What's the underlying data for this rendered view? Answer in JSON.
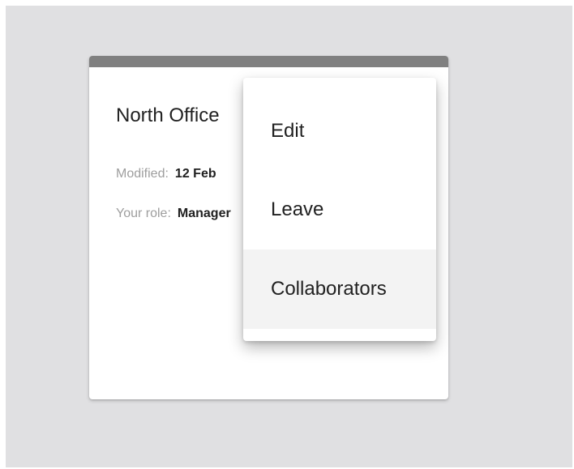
{
  "card": {
    "title": "North Office",
    "modified_label": "Modified:",
    "modified_value": "12 Feb",
    "role_label": "Your role:",
    "role_value": "Manager",
    "topbar_color": "#808080"
  },
  "menu": {
    "items": [
      {
        "label": "Edit"
      },
      {
        "label": "Leave"
      },
      {
        "label": "Collaborators",
        "highlighted": true
      }
    ]
  }
}
